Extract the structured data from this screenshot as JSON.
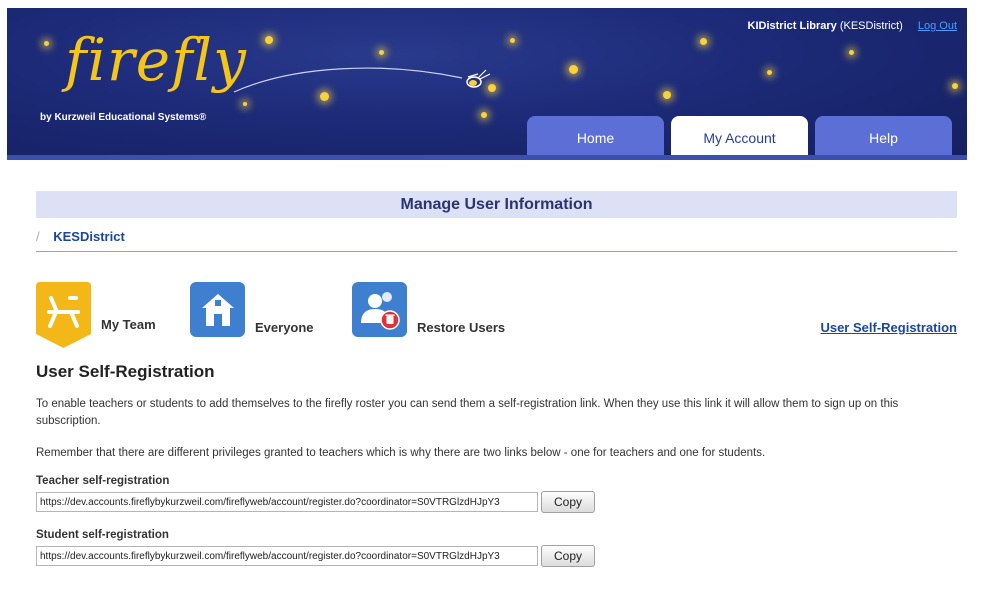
{
  "header": {
    "logo_text": "firefly",
    "tagline": "by Kurzweil Educational Systems®",
    "account_name": "KIDistrict Library",
    "account_code": "(KESDistrict)",
    "logout_label": "Log Out"
  },
  "tabs": [
    {
      "label": "Home",
      "active": false
    },
    {
      "label": "My Account",
      "active": true
    },
    {
      "label": "Help",
      "active": false
    }
  ],
  "page": {
    "title": "Manage User Information",
    "breadcrumb_sep": "/",
    "breadcrumb": "KESDistrict"
  },
  "actions": [
    {
      "label": "My Team",
      "icon": "teacher-desk-icon",
      "color": "#f3b817"
    },
    {
      "label": "Everyone",
      "icon": "schoolhouse-icon",
      "color": "#3f7fd0"
    },
    {
      "label": "Restore Users",
      "icon": "restore-users-icon",
      "color": "#3f7fd0"
    }
  ],
  "self_registration_link": "User Self-Registration",
  "content": {
    "heading": "User Self-Registration",
    "para1": "To enable teachers or students to add themselves to the firefly roster you can send them a self-registration link. When they use this link it will allow them to sign up on this subscription.",
    "para2": "Remember that there are different privileges granted to teachers which is why there are two links below - one for teachers and one for students.",
    "teacher_label": "Teacher self-registration",
    "teacher_url": "https://dev.accounts.fireflybykurzweil.com/fireflyweb/account/register.do?coordinator=S0VTRGlzdHJpY3",
    "student_label": "Student self-registration",
    "student_url": "https://dev.accounts.fireflybykurzweil.com/fireflyweb/account/register.do?coordinator=S0VTRGlzdHJpY3",
    "copy_label": "Copy"
  },
  "colors": {
    "header_bg": "#1c2a78",
    "tab_bg": "#5b6fd6",
    "title_bar_bg": "#dce1f5",
    "link": "#1a46a0",
    "star": "#f7d23a"
  }
}
